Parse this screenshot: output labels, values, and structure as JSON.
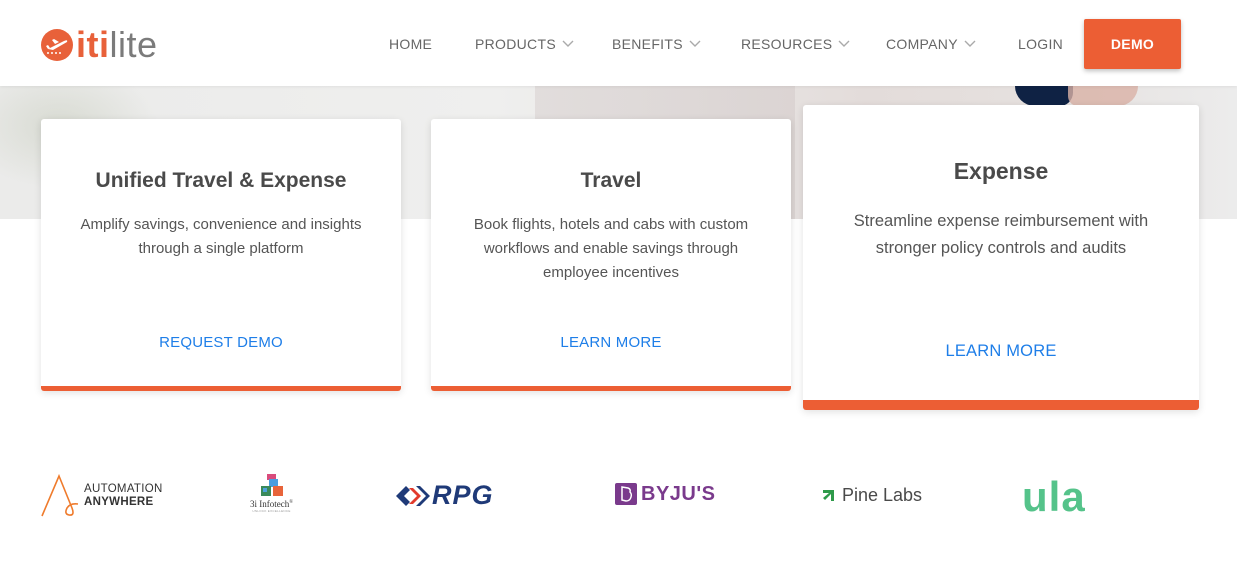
{
  "brand": {
    "name_part1": "iti",
    "name_part2": "lite",
    "logo_icon": "plane-in-circle-icon",
    "accent_color": "#ec5e34",
    "link_color": "#1e7ee8"
  },
  "nav": {
    "items": [
      {
        "label": "HOME",
        "has_dropdown": false
      },
      {
        "label": "PRODUCTS",
        "has_dropdown": true
      },
      {
        "label": "BENEFITS",
        "has_dropdown": true
      },
      {
        "label": "RESOURCES",
        "has_dropdown": true
      },
      {
        "label": "COMPANY",
        "has_dropdown": true
      },
      {
        "label": "LOGIN",
        "has_dropdown": false
      }
    ],
    "demo_label": "DEMO"
  },
  "cards": [
    {
      "title": "Unified Travel & Expense",
      "description": "Amplify savings, convenience and insights through a single platform",
      "link_label": "REQUEST DEMO"
    },
    {
      "title": "Travel",
      "description": "Book flights, hotels and cabs with custom workflows and enable savings through employee incentives",
      "link_label": "LEARN MORE"
    },
    {
      "title": "Expense",
      "description": "Streamline expense reimbursement with stronger policy controls and audits",
      "link_label": "LEARN MORE"
    }
  ],
  "clients": {
    "automation_anywhere": {
      "line1": "AUTOMATION",
      "line2": "ANYWHERE"
    },
    "infotech": {
      "name": "3i Infotech",
      "mark": "®",
      "tagline": "UNLOCK EXCELLENCE"
    },
    "rpg": {
      "name": "RPG"
    },
    "byjus": {
      "name": "BYJU'S"
    },
    "pine_labs": {
      "name": "Pine Labs"
    },
    "ula": {
      "name": "ula"
    }
  }
}
